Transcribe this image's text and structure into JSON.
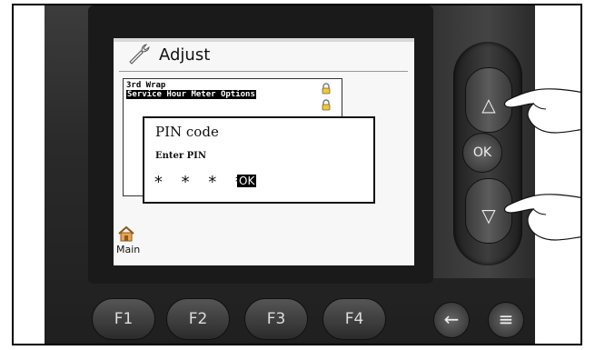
{
  "screen": {
    "title": "Adjust",
    "list": [
      "3rd Wrap",
      "Service Hour Meter Options"
    ],
    "dialog": {
      "title": "PIN code",
      "label": "Enter PIN",
      "value": "* * * *",
      "ok_label": "OK"
    },
    "home_label": "Main"
  },
  "nav": {
    "up": "△",
    "ok": "OK",
    "down": "▽"
  },
  "function_keys": [
    "F1",
    "F2",
    "F3",
    "F4"
  ],
  "side_keys": {
    "back": "←",
    "menu": "≡"
  },
  "icons": {
    "title": "wrench-icon",
    "lock": "padlock-icon",
    "home": "home-icon",
    "hand": "pointing-hand-icon"
  },
  "colors": {
    "device_body": "#2a2a2a",
    "screen_bg": "#f7f7f7",
    "highlight": "#000000"
  }
}
